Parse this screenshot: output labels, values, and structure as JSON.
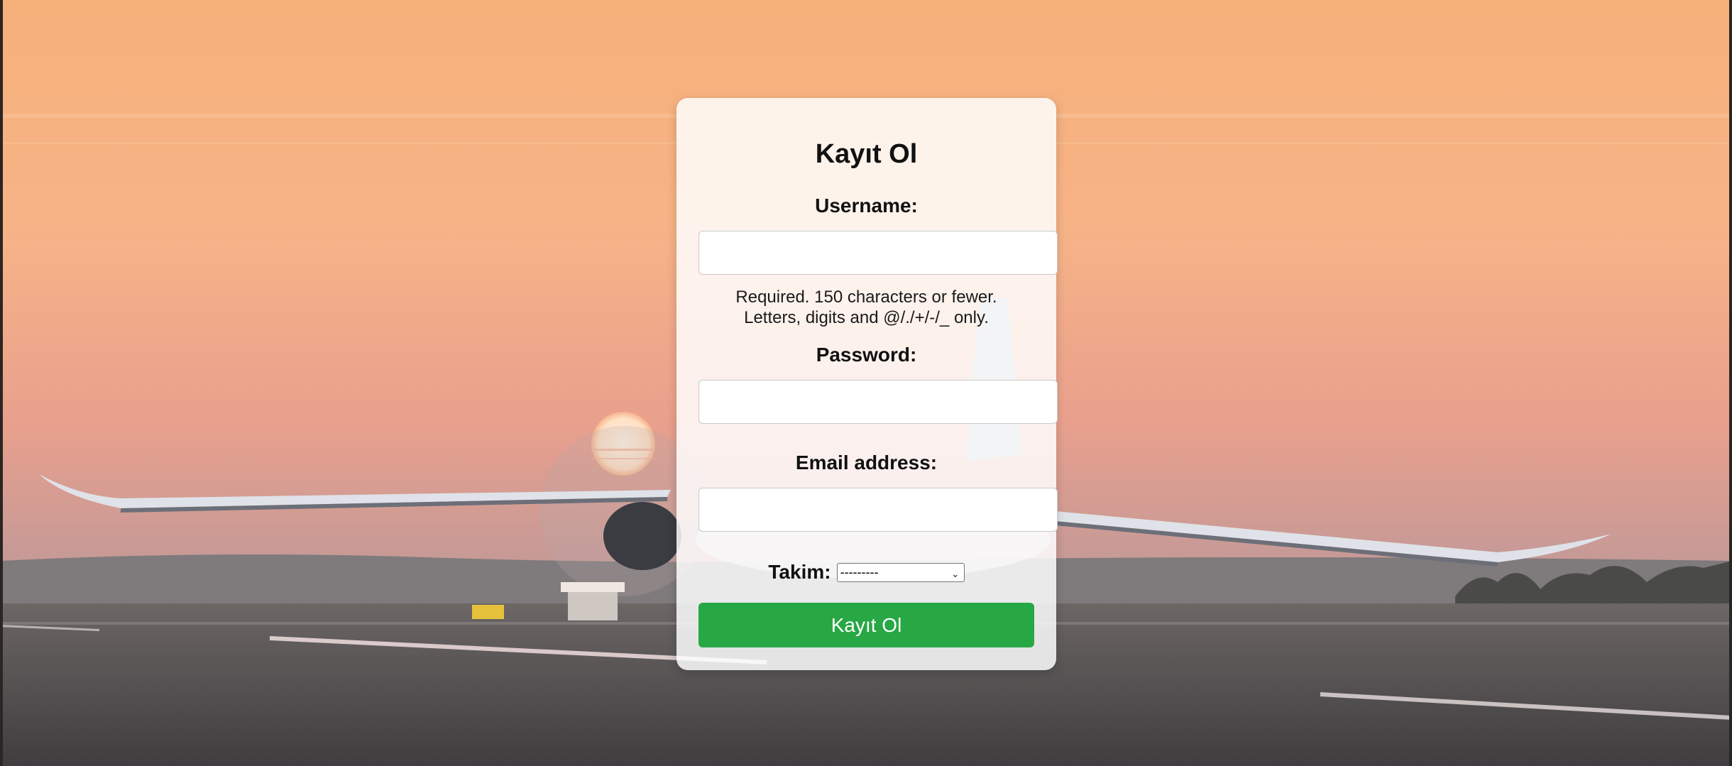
{
  "form": {
    "title": "Kayıt Ol",
    "username_label": "Username:",
    "username_value": "",
    "username_help_line1": "Required. 150 characters or fewer.",
    "username_help_line2": "Letters, digits and @/./+/-/_ only.",
    "password_label": "Password:",
    "password_value": "",
    "email_label": "Email address:",
    "email_value": "",
    "takim_label": "Takim:",
    "takim_selected": "---------",
    "submit_label": "Kayıt Ol"
  },
  "colors": {
    "submit_bg": "#28a745",
    "card_bg": "#ffffff"
  }
}
